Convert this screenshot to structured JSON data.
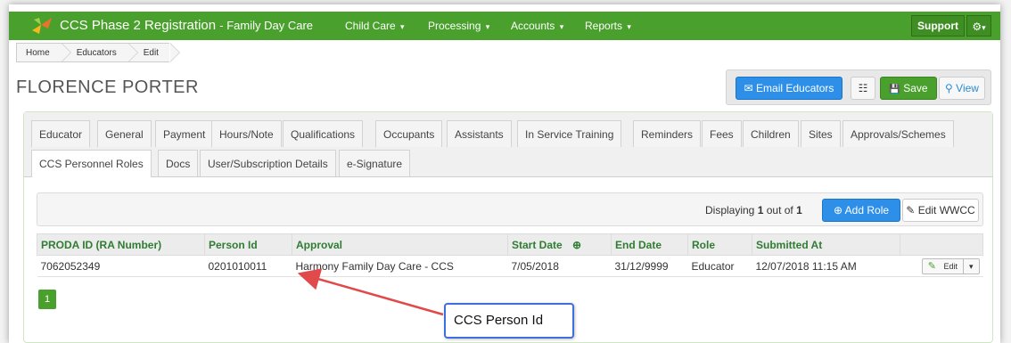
{
  "navbar": {
    "brand_title": "CCS Phase 2 Registration",
    "brand_subtitle": "- Family Day Care",
    "menu": [
      {
        "label": "Child Care"
      },
      {
        "label": "Processing"
      },
      {
        "label": "Accounts"
      },
      {
        "label": "Reports"
      }
    ],
    "support_label": "Support",
    "caret": "▾",
    "gear_glyph": "⚙",
    "accent_color": "#4aa02c"
  },
  "breadcrumb": [
    "Home",
    "Educators",
    "Edit"
  ],
  "page_title": "FLORENCE PORTER",
  "actions": {
    "email_label": "Email Educators",
    "email_icon": "✉",
    "list_icon": "☷",
    "save_label": "Save",
    "save_icon": "💾",
    "view_label": "View",
    "view_icon": "⚲"
  },
  "tabs_row1": [
    "Educator",
    "General",
    "Payment",
    "Hours/Note",
    "Qualifications",
    "Occupants",
    "Assistants",
    "In Service Training",
    "Reminders",
    "Fees",
    "Children",
    "Sites",
    "Approvals/Schemes"
  ],
  "tabs_row2": [
    "CCS Personnel Roles",
    "Docs",
    "User/Subscription Details",
    "e-Signature"
  ],
  "toolbar": {
    "displaying_prefix": "Displaying ",
    "displaying_count": "1",
    "displaying_mid": " out of ",
    "displaying_total": "1",
    "add_role_label": "Add Role",
    "add_role_icon": "⊕",
    "edit_wwcc_label": "Edit WWCC",
    "edit_wwcc_icon": "✎"
  },
  "table": {
    "columns": [
      "PRODA ID (RA Number)",
      "Person Id",
      "Approval",
      "Start Date",
      "End Date",
      "Role",
      "Submitted At",
      ""
    ],
    "sort_icon": "⊕",
    "rows": [
      {
        "proda_id": "7062052349",
        "person_id": "0201010011",
        "approval": "Harmony Family Day Care - CCS",
        "start_date": "7/05/2018",
        "end_date": "31/12/9999",
        "role": "Educator",
        "submitted_at": "12/07/2018 11:15 AM",
        "edit_label": "Edit",
        "edit_icon": "✎"
      }
    ]
  },
  "pagination": {
    "current_page": "1"
  },
  "annotation": {
    "label": "CCS Person Id",
    "arrow_color": "#e04a4a"
  }
}
